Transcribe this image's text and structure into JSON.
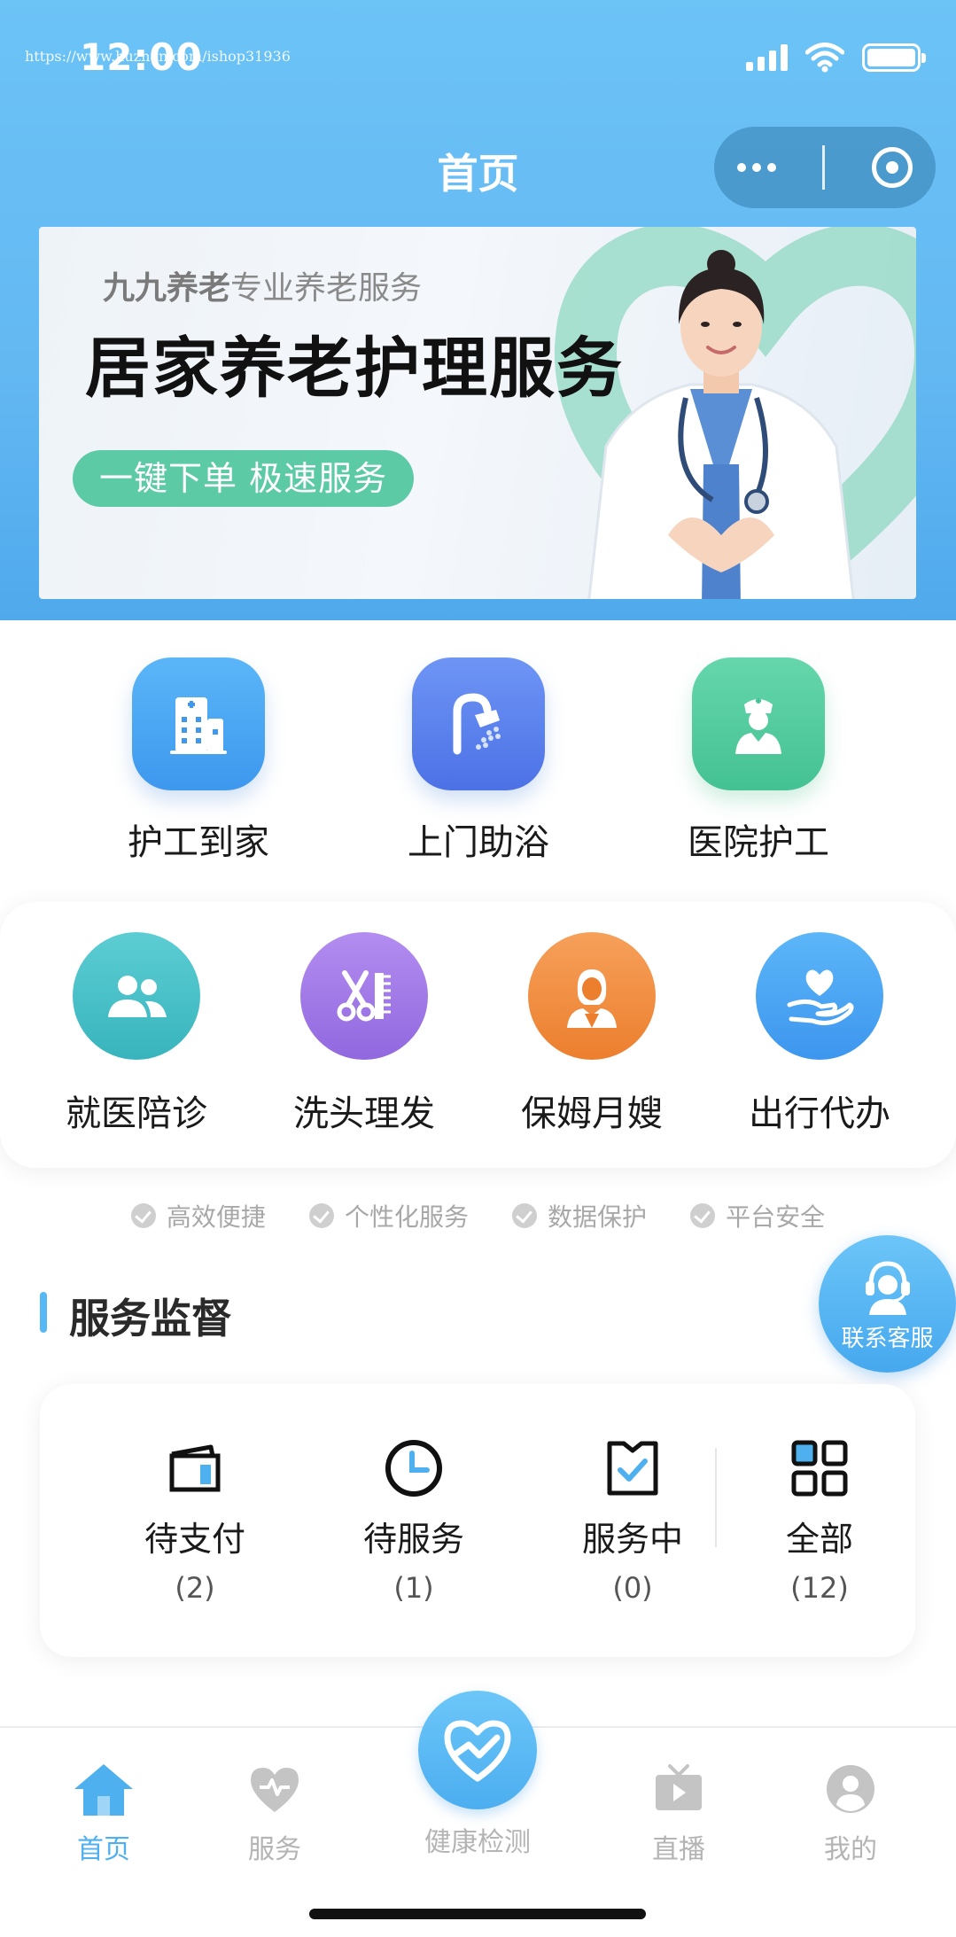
{
  "status_bar": {
    "time": "12:00",
    "watermark": "https://www.huzhan.com/ishop31936"
  },
  "nav": {
    "title": "首页"
  },
  "banner": {
    "brand_bold": "九九养老",
    "brand_rest": "专业养老服务",
    "title": "居家养老护理服务",
    "pill": "一键下单 极速服务",
    "accent_color": "#5dcaa6"
  },
  "main_services": [
    {
      "label": "护工到家",
      "icon": "hospital-building-icon",
      "color": "#4aa6f3"
    },
    {
      "label": "上门助浴",
      "icon": "shower-icon",
      "color": "#5b82ee"
    },
    {
      "label": "医院护工",
      "icon": "nurse-icon",
      "color": "#54cca0"
    }
  ],
  "more_services": [
    {
      "label": "就医陪诊",
      "icon": "people-icon",
      "color": "#45c1c8"
    },
    {
      "label": "洗头理发",
      "icon": "scissors-comb-icon",
      "color": "#a17ee6"
    },
    {
      "label": "保姆月嫂",
      "icon": "housekeeper-icon",
      "color": "#f0893a"
    },
    {
      "label": "出行代办",
      "icon": "hand-heart-icon",
      "color": "#4aa8f4"
    }
  ],
  "features": [
    "高效便捷",
    "个性化服务",
    "数据保护",
    "平台安全"
  ],
  "supervision": {
    "title": "服务监督",
    "orders": [
      {
        "label": "待支付",
        "count": "(2)",
        "icon": "wallet-icon"
      },
      {
        "label": "待服务",
        "count": "(1)",
        "icon": "clock-icon"
      },
      {
        "label": "服务中",
        "count": "(0)",
        "icon": "clipboard-check-icon"
      },
      {
        "label": "全部",
        "count": "(12)",
        "icon": "grid-icon"
      }
    ]
  },
  "customer_service": {
    "label": "联系客服"
  },
  "tabbar": {
    "tabs": [
      {
        "label": "首页",
        "icon": "home-icon",
        "active": true
      },
      {
        "label": "服务",
        "icon": "heart-icon",
        "active": false
      },
      {
        "label": "健康检测",
        "icon": "heart-pulse-icon",
        "active": false
      },
      {
        "label": "直播",
        "icon": "tv-icon",
        "active": false
      },
      {
        "label": "我的",
        "icon": "user-icon",
        "active": false
      }
    ],
    "active_color": "#4fb0f0",
    "inactive_color": "#b4b4b4"
  }
}
